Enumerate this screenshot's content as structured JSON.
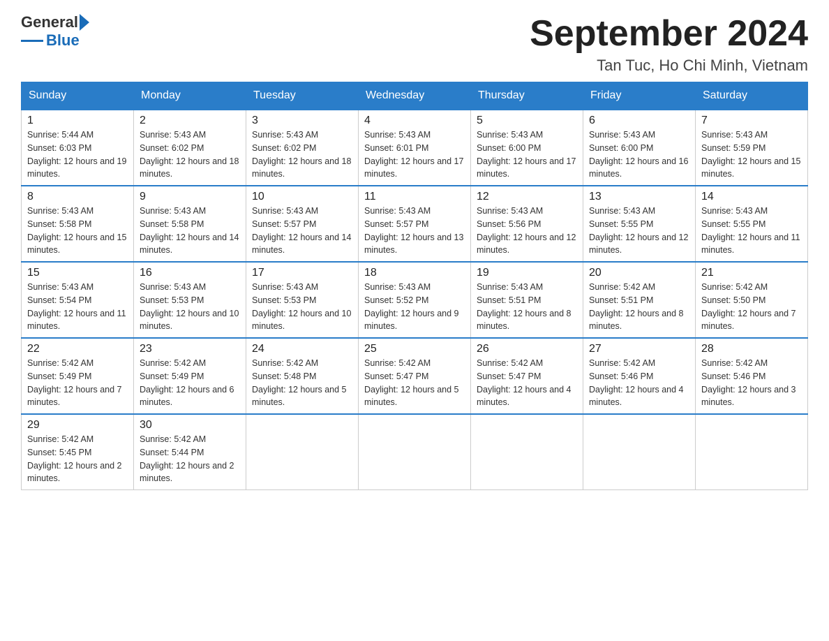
{
  "header": {
    "logo_text_general": "General",
    "logo_text_blue": "Blue",
    "main_title": "September 2024",
    "subtitle": "Tan Tuc, Ho Chi Minh, Vietnam"
  },
  "days_of_week": [
    "Sunday",
    "Monday",
    "Tuesday",
    "Wednesday",
    "Thursday",
    "Friday",
    "Saturday"
  ],
  "weeks": [
    [
      {
        "day": "1",
        "sunrise": "Sunrise: 5:44 AM",
        "sunset": "Sunset: 6:03 PM",
        "daylight": "Daylight: 12 hours and 19 minutes."
      },
      {
        "day": "2",
        "sunrise": "Sunrise: 5:43 AM",
        "sunset": "Sunset: 6:02 PM",
        "daylight": "Daylight: 12 hours and 18 minutes."
      },
      {
        "day": "3",
        "sunrise": "Sunrise: 5:43 AM",
        "sunset": "Sunset: 6:02 PM",
        "daylight": "Daylight: 12 hours and 18 minutes."
      },
      {
        "day": "4",
        "sunrise": "Sunrise: 5:43 AM",
        "sunset": "Sunset: 6:01 PM",
        "daylight": "Daylight: 12 hours and 17 minutes."
      },
      {
        "day": "5",
        "sunrise": "Sunrise: 5:43 AM",
        "sunset": "Sunset: 6:00 PM",
        "daylight": "Daylight: 12 hours and 17 minutes."
      },
      {
        "day": "6",
        "sunrise": "Sunrise: 5:43 AM",
        "sunset": "Sunset: 6:00 PM",
        "daylight": "Daylight: 12 hours and 16 minutes."
      },
      {
        "day": "7",
        "sunrise": "Sunrise: 5:43 AM",
        "sunset": "Sunset: 5:59 PM",
        "daylight": "Daylight: 12 hours and 15 minutes."
      }
    ],
    [
      {
        "day": "8",
        "sunrise": "Sunrise: 5:43 AM",
        "sunset": "Sunset: 5:58 PM",
        "daylight": "Daylight: 12 hours and 15 minutes."
      },
      {
        "day": "9",
        "sunrise": "Sunrise: 5:43 AM",
        "sunset": "Sunset: 5:58 PM",
        "daylight": "Daylight: 12 hours and 14 minutes."
      },
      {
        "day": "10",
        "sunrise": "Sunrise: 5:43 AM",
        "sunset": "Sunset: 5:57 PM",
        "daylight": "Daylight: 12 hours and 14 minutes."
      },
      {
        "day": "11",
        "sunrise": "Sunrise: 5:43 AM",
        "sunset": "Sunset: 5:57 PM",
        "daylight": "Daylight: 12 hours and 13 minutes."
      },
      {
        "day": "12",
        "sunrise": "Sunrise: 5:43 AM",
        "sunset": "Sunset: 5:56 PM",
        "daylight": "Daylight: 12 hours and 12 minutes."
      },
      {
        "day": "13",
        "sunrise": "Sunrise: 5:43 AM",
        "sunset": "Sunset: 5:55 PM",
        "daylight": "Daylight: 12 hours and 12 minutes."
      },
      {
        "day": "14",
        "sunrise": "Sunrise: 5:43 AM",
        "sunset": "Sunset: 5:55 PM",
        "daylight": "Daylight: 12 hours and 11 minutes."
      }
    ],
    [
      {
        "day": "15",
        "sunrise": "Sunrise: 5:43 AM",
        "sunset": "Sunset: 5:54 PM",
        "daylight": "Daylight: 12 hours and 11 minutes."
      },
      {
        "day": "16",
        "sunrise": "Sunrise: 5:43 AM",
        "sunset": "Sunset: 5:53 PM",
        "daylight": "Daylight: 12 hours and 10 minutes."
      },
      {
        "day": "17",
        "sunrise": "Sunrise: 5:43 AM",
        "sunset": "Sunset: 5:53 PM",
        "daylight": "Daylight: 12 hours and 10 minutes."
      },
      {
        "day": "18",
        "sunrise": "Sunrise: 5:43 AM",
        "sunset": "Sunset: 5:52 PM",
        "daylight": "Daylight: 12 hours and 9 minutes."
      },
      {
        "day": "19",
        "sunrise": "Sunrise: 5:43 AM",
        "sunset": "Sunset: 5:51 PM",
        "daylight": "Daylight: 12 hours and 8 minutes."
      },
      {
        "day": "20",
        "sunrise": "Sunrise: 5:42 AM",
        "sunset": "Sunset: 5:51 PM",
        "daylight": "Daylight: 12 hours and 8 minutes."
      },
      {
        "day": "21",
        "sunrise": "Sunrise: 5:42 AM",
        "sunset": "Sunset: 5:50 PM",
        "daylight": "Daylight: 12 hours and 7 minutes."
      }
    ],
    [
      {
        "day": "22",
        "sunrise": "Sunrise: 5:42 AM",
        "sunset": "Sunset: 5:49 PM",
        "daylight": "Daylight: 12 hours and 7 minutes."
      },
      {
        "day": "23",
        "sunrise": "Sunrise: 5:42 AM",
        "sunset": "Sunset: 5:49 PM",
        "daylight": "Daylight: 12 hours and 6 minutes."
      },
      {
        "day": "24",
        "sunrise": "Sunrise: 5:42 AM",
        "sunset": "Sunset: 5:48 PM",
        "daylight": "Daylight: 12 hours and 5 minutes."
      },
      {
        "day": "25",
        "sunrise": "Sunrise: 5:42 AM",
        "sunset": "Sunset: 5:47 PM",
        "daylight": "Daylight: 12 hours and 5 minutes."
      },
      {
        "day": "26",
        "sunrise": "Sunrise: 5:42 AM",
        "sunset": "Sunset: 5:47 PM",
        "daylight": "Daylight: 12 hours and 4 minutes."
      },
      {
        "day": "27",
        "sunrise": "Sunrise: 5:42 AM",
        "sunset": "Sunset: 5:46 PM",
        "daylight": "Daylight: 12 hours and 4 minutes."
      },
      {
        "day": "28",
        "sunrise": "Sunrise: 5:42 AM",
        "sunset": "Sunset: 5:46 PM",
        "daylight": "Daylight: 12 hours and 3 minutes."
      }
    ],
    [
      {
        "day": "29",
        "sunrise": "Sunrise: 5:42 AM",
        "sunset": "Sunset: 5:45 PM",
        "daylight": "Daylight: 12 hours and 2 minutes."
      },
      {
        "day": "30",
        "sunrise": "Sunrise: 5:42 AM",
        "sunset": "Sunset: 5:44 PM",
        "daylight": "Daylight: 12 hours and 2 minutes."
      },
      null,
      null,
      null,
      null,
      null
    ]
  ]
}
